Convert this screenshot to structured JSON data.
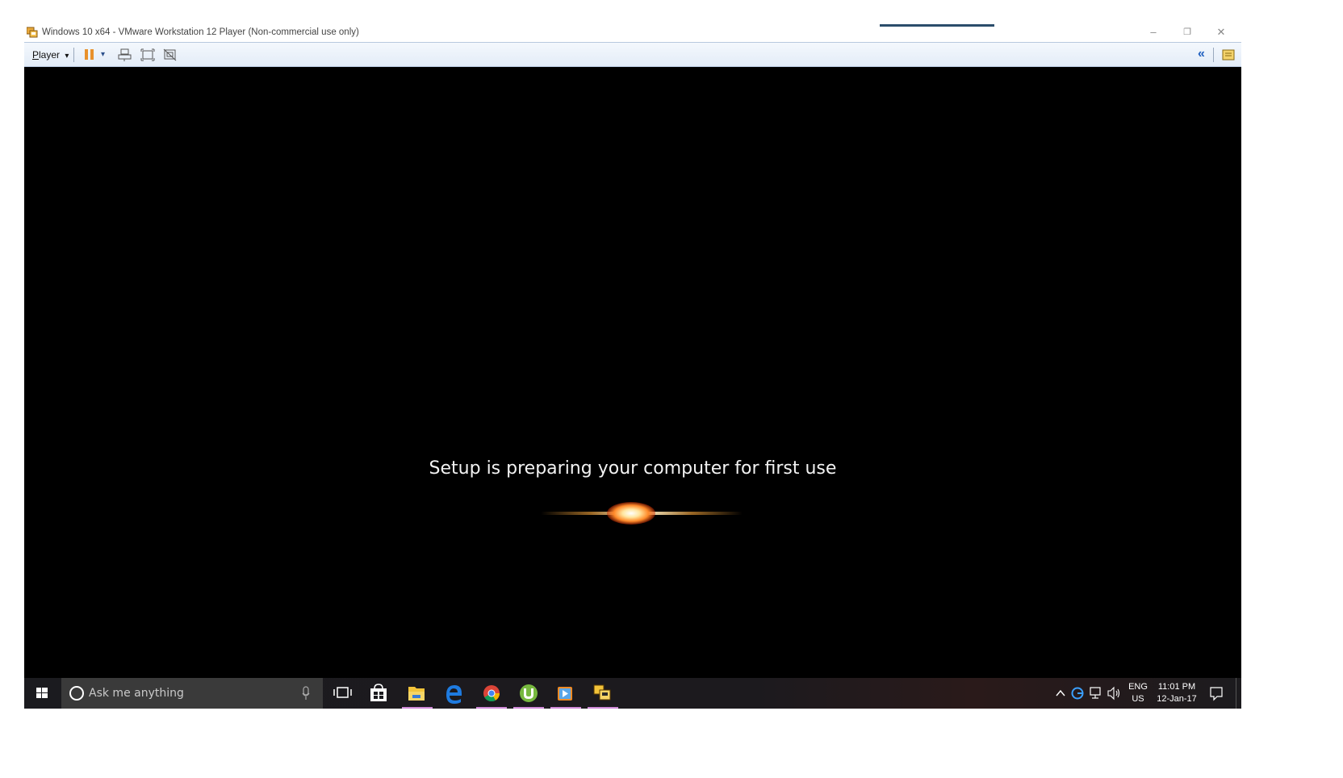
{
  "window": {
    "title": "Windows 10 x64 - VMware Workstation 12 Player (Non-commercial use only)",
    "controls": {
      "minimize": "–",
      "restore": "❐",
      "close": "✕"
    }
  },
  "toolbar": {
    "player_first": "P",
    "player_rest": "layer",
    "player_arrow": "▾",
    "pause_arrow": "▾",
    "collapse": "«"
  },
  "vm": {
    "setup_message": "Setup is preparing your computer for first use"
  },
  "taskbar": {
    "search_placeholder": "Ask me anything",
    "pinned": [
      "task-view",
      "store",
      "file-explorer",
      "edge",
      "chrome",
      "utorrent",
      "media-player",
      "vmware-player"
    ],
    "tray": {
      "language_line1": "ENG",
      "language_line2": "US",
      "time": "11:01 PM",
      "date": "12-Jan-17"
    }
  },
  "colors": {
    "toolbar_bg": "#e3ecf7",
    "vm_bg": "#000000",
    "taskbar_bg": "#1b1b1f",
    "active_app_underline": "#d08ad8",
    "pause_orange": "#e8912b"
  }
}
